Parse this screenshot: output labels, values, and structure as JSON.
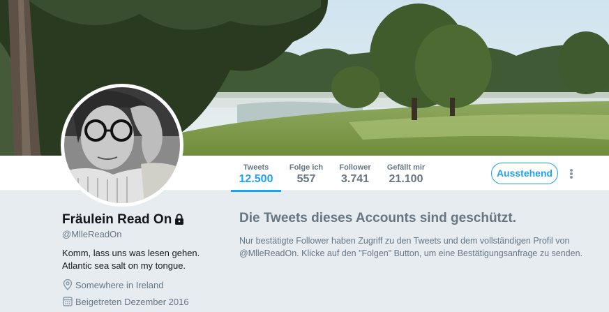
{
  "banner": {
    "icon": "banner-photo-park-trees"
  },
  "profile": {
    "avatar_icon": "avatar-photo",
    "name": "Fräulein Read On",
    "lock_icon": "lock-icon",
    "handle": "@MlleReadOn",
    "bio_line1": "Komm, lass uns was lesen gehen.",
    "bio_line2": "Atlantic sea salt on my tongue.",
    "location": "Somewhere in Ireland",
    "location_icon": "location-pin-icon",
    "joined": "Beigetreten Dezember 2016",
    "joined_icon": "calendar-icon"
  },
  "nav": {
    "stats": [
      {
        "label": "Tweets",
        "value": "12.500"
      },
      {
        "label": "Folge ich",
        "value": "557"
      },
      {
        "label": "Follower",
        "value": "3.741"
      },
      {
        "label": "Gefällt mir",
        "value": "21.100"
      }
    ],
    "pending_label": "Ausstehend",
    "more_icon": "more-vertical-icon"
  },
  "protected": {
    "title": "Die Tweets dieses Accounts sind geschützt.",
    "line1": "Nur bestätigte Follower haben Zugriff zu den Tweets und dem vollständigen Profil von",
    "line2": "@MlleReadOn. Klicke auf den \"Folgen\" Button, um eine Bestätigungsanfrage zu senden."
  },
  "colors": {
    "accent": "#1da1f2",
    "background": "#e6ecf0",
    "muted": "#657786"
  }
}
